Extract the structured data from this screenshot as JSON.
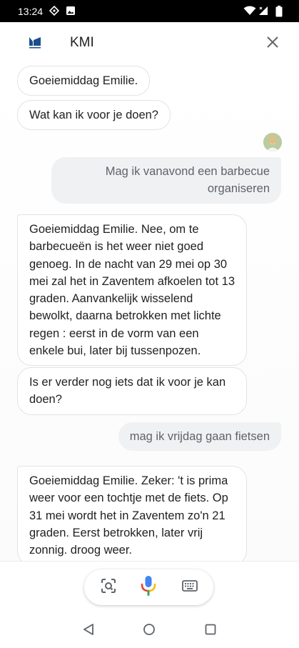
{
  "status_bar": {
    "time": "13:24",
    "left_icons": [
      "compass-icon",
      "image-icon"
    ],
    "right_icons": [
      "wifi-icon",
      "signal-icon",
      "battery-icon"
    ]
  },
  "header": {
    "logo_icon": "kmi-logo-icon",
    "title": "KMI",
    "close_icon": "close-icon"
  },
  "chat": {
    "greeting": "Goeiemiddag Emilie.",
    "offer": "Wat kan ik voor je doen?",
    "user_question_1": "Mag ik vanavond een barbecue organiseren",
    "reply_1": "Goeiemiddag Emilie. Nee, om te barbecueën is het weer niet goed genoeg. In de nacht van 29 mei op 30 mei zal het in Zaventem afkoelen tot 13 graden.  Aanvankelijk wisselend bewolkt, daarna betrokken met lichte regen : eerst in de vorm van een enkele bui, later bij tussenpozen.",
    "follow_up": "Is er verder nog iets dat ik voor je kan doen?",
    "user_question_2": "mag ik vrijdag gaan fietsen",
    "reply_2": "Goeiemiddag Emilie. Zeker: 't is prima weer voor een tochtje met de fiets. Op 31 mei wordt het in Zaventem zo'n 21 graden.  Eerst betrokken, later vrij zonnig. droog weer."
  },
  "input_bar": {
    "icons": [
      "lens-icon",
      "microphone-icon",
      "keyboard-icon"
    ]
  },
  "nav_bar": {
    "icons": [
      "back-icon",
      "home-icon",
      "recents-icon"
    ]
  },
  "colors": {
    "status_bar_bg": "#000000",
    "bot_bubble_bg": "#ffffff",
    "bot_bubble_border": "#e3e3e3",
    "user_bubble_bg": "#eff1f3",
    "user_text": "#5f6368",
    "kmi_blue": "#1a4f8b",
    "google_blue": "#4285f4",
    "google_red": "#ea4335",
    "google_yellow": "#fbbc05",
    "google_green": "#34a853"
  }
}
